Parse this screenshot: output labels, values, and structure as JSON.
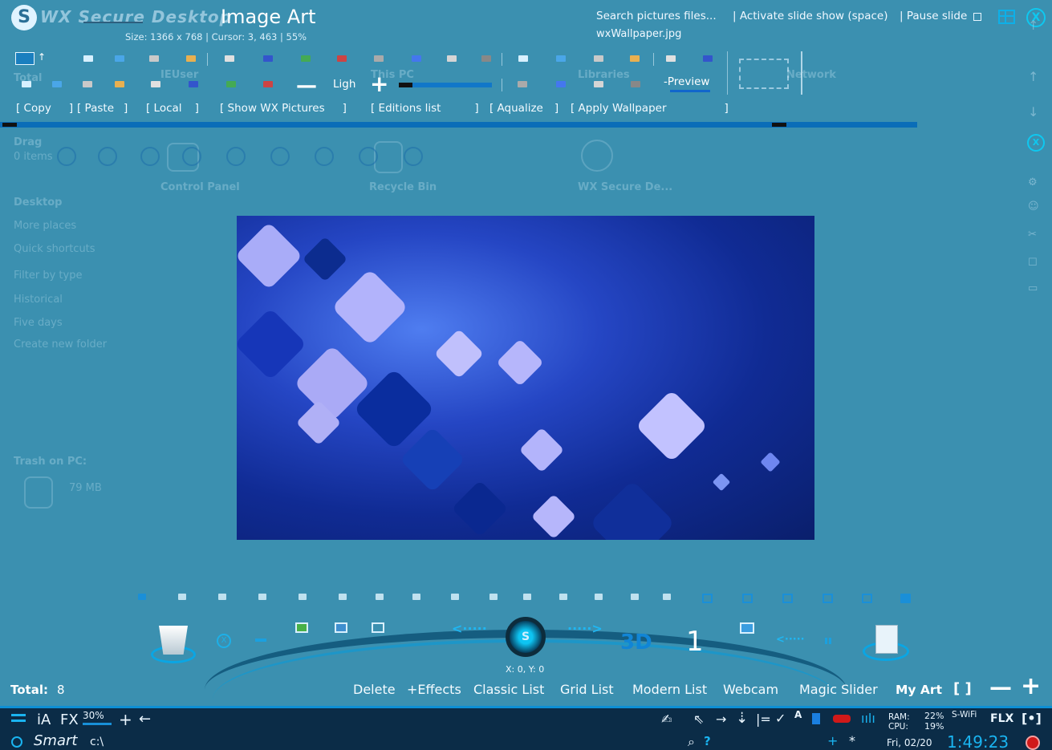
{
  "header": {
    "logo_letter": "S",
    "app_name": "WX Secure Desktop",
    "title": "Image Art",
    "info": "Size: 1366 x 768 | Cursor: 3, 463 | 55%",
    "search": "Search pictures files...",
    "filename": "wxWallpaper.jpg",
    "slideshow": "| Activate slide show (space)",
    "pause": "| Pause slide",
    "close_icon": "X"
  },
  "toolbar": {
    "light_label": "Ligh",
    "minus": "—",
    "plus": "+",
    "brightness_level": 0.15,
    "preview_label": "-Preview"
  },
  "commands": [
    {
      "label": "[ Copy",
      "close": "]"
    },
    {
      "label": "[ Paste",
      "close": "]"
    },
    {
      "label": "[ Local",
      "close": "]"
    },
    {
      "label": "[ Show WX Pictures",
      "close": "]"
    },
    {
      "label": "[ Editions list",
      "close": "]"
    },
    {
      "label": "[ Aqualize",
      "close": "]"
    },
    {
      "label": "[ Apply Wallpaper",
      "close": "]"
    }
  ],
  "ghost_desktop": {
    "items": [
      "Total",
      "IEUser",
      "This PC",
      "Libraries",
      "Network",
      "Drag",
      "0 items",
      "Desktop",
      "More places",
      "Quick shortcuts",
      "Filter by type",
      "Historical",
      "Five days",
      "Create new folder",
      "Trash on PC:",
      "79 MB",
      "Control Panel",
      "Recycle Bin",
      "WX Secure De..."
    ]
  },
  "dock": {
    "logo_letter": "S",
    "left_arrows": "<·····",
    "right_arrows": "·····>",
    "mode_3d": "3D",
    "count": "1",
    "coords": "X: 0, Y: 0"
  },
  "bottom_bar": {
    "total_label": "Total:",
    "total_value": "8",
    "actions": [
      "Delete",
      "+Effects",
      "Classic List",
      "Grid List",
      "Modern List",
      "Webcam",
      "Magic Slider"
    ],
    "my_art": "My Art",
    "bracket": "[ ]",
    "minus": "—",
    "plus": "+"
  },
  "taskbar": {
    "ia": "iA",
    "fx": "FX",
    "percent": "30%",
    "plus": "+",
    "back": "←",
    "smart": "Smart",
    "path": "c:\\",
    "ram_label": "RAM:",
    "ram_value": "22%",
    "cpu_label": "CPU:",
    "cpu_value": "19%",
    "wifi": "S-WiFi",
    "flx": "FLX",
    "date": "Fri, 02/20",
    "time": "1:49:23",
    "search_q": "?"
  },
  "colors": {
    "background": "#3b90b0",
    "accent": "#0e8fd4",
    "taskbar": "#0b2c47",
    "close": "#0ec8f0"
  }
}
